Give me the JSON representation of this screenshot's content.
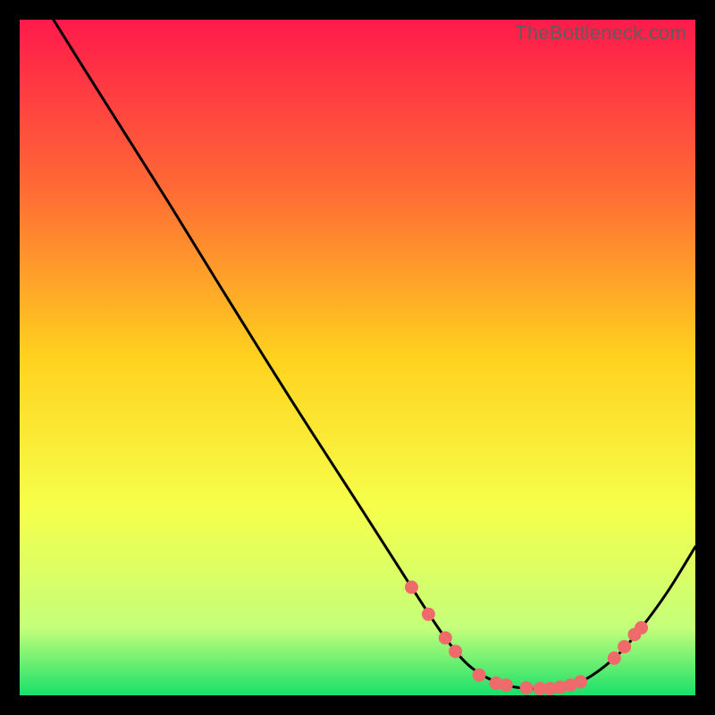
{
  "watermark": "TheBottleneck.com",
  "chart_data": {
    "type": "line",
    "title": "",
    "xlabel": "",
    "ylabel": "",
    "xlim": [
      0,
      100
    ],
    "ylim": [
      0,
      100
    ],
    "gradient_stops": [
      {
        "offset": 0,
        "color": "#ff1a4b"
      },
      {
        "offset": 25,
        "color": "#ff6a35"
      },
      {
        "offset": 50,
        "color": "#ffd21e"
      },
      {
        "offset": 72,
        "color": "#f6ff4a"
      },
      {
        "offset": 90,
        "color": "#c4ff7a"
      },
      {
        "offset": 100,
        "color": "#18e06a"
      }
    ],
    "curve": [
      {
        "x": 5.0,
        "y": 100.0
      },
      {
        "x": 10.0,
        "y": 92.0
      },
      {
        "x": 16.0,
        "y": 82.5
      },
      {
        "x": 22.0,
        "y": 73.0
      },
      {
        "x": 30.0,
        "y": 60.0
      },
      {
        "x": 40.0,
        "y": 44.0
      },
      {
        "x": 50.0,
        "y": 28.5
      },
      {
        "x": 58.0,
        "y": 16.0
      },
      {
        "x": 63.0,
        "y": 8.5
      },
      {
        "x": 67.0,
        "y": 4.0
      },
      {
        "x": 72.0,
        "y": 1.5
      },
      {
        "x": 78.0,
        "y": 1.0
      },
      {
        "x": 83.0,
        "y": 2.0
      },
      {
        "x": 88.0,
        "y": 5.5
      },
      {
        "x": 92.0,
        "y": 10.0
      },
      {
        "x": 96.0,
        "y": 15.5
      },
      {
        "x": 100.0,
        "y": 22.0
      }
    ],
    "markers": [
      {
        "x": 58.0,
        "y": 16.0
      },
      {
        "x": 60.5,
        "y": 12.0
      },
      {
        "x": 63.0,
        "y": 8.5
      },
      {
        "x": 64.5,
        "y": 6.5
      },
      {
        "x": 68.0,
        "y": 3.0
      },
      {
        "x": 70.5,
        "y": 1.8
      },
      {
        "x": 72.0,
        "y": 1.5
      },
      {
        "x": 75.0,
        "y": 1.1
      },
      {
        "x": 77.0,
        "y": 1.0
      },
      {
        "x": 78.5,
        "y": 1.0
      },
      {
        "x": 80.0,
        "y": 1.2
      },
      {
        "x": 81.5,
        "y": 1.5
      },
      {
        "x": 83.0,
        "y": 2.0
      },
      {
        "x": 88.0,
        "y": 5.5
      },
      {
        "x": 89.5,
        "y": 7.2
      },
      {
        "x": 91.0,
        "y": 9.0
      },
      {
        "x": 92.0,
        "y": 10.0
      }
    ]
  }
}
